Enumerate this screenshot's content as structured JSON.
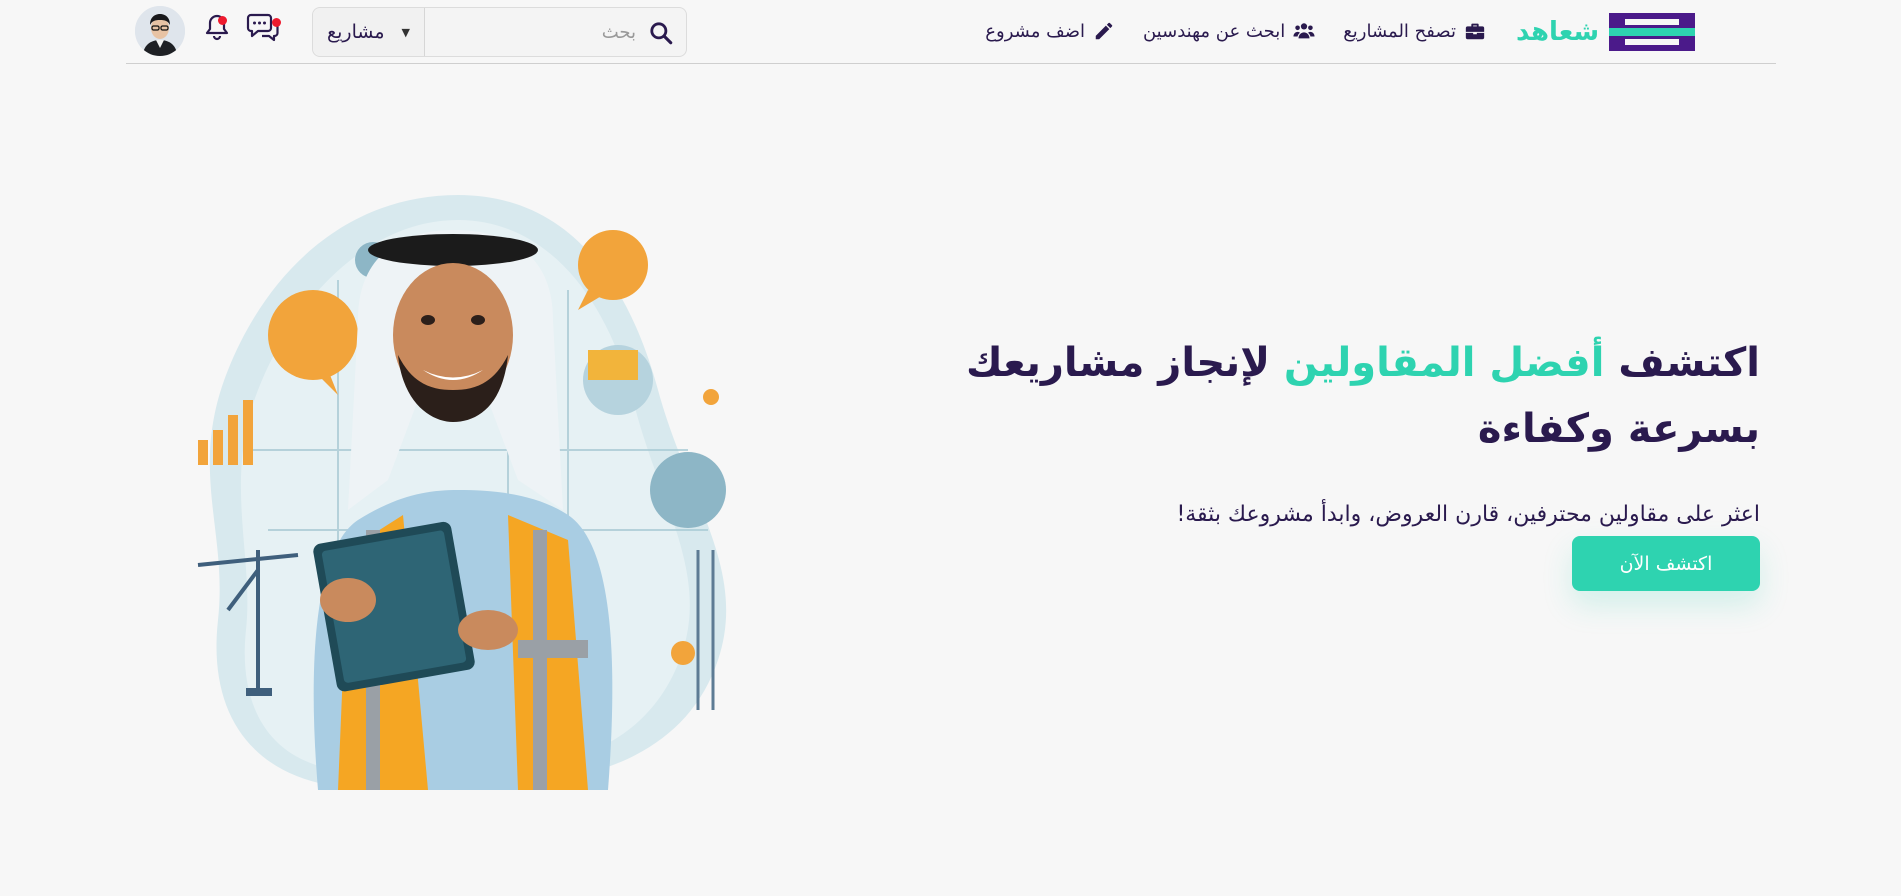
{
  "header": {
    "logo_text": "شعاهد",
    "nav": {
      "add_project": "اضف مشروع",
      "find_engineers": "ابحث عن مهندسين",
      "browse_projects": "تصفح المشاريع"
    },
    "search": {
      "placeholder": "بحث",
      "category_selected": "مشاريع"
    },
    "notifications": {
      "chat_unread": true,
      "bell_unread": true
    }
  },
  "hero": {
    "title_part1": "اكتشف ",
    "title_accent": "أفضل المقاولين",
    "title_part2": " لإنجاز مشاريعك بسرعة وكفاءة",
    "subtitle": "اعثر على مقاولين محترفين، قارن العروض، وابدأ مشروعك بثقة!",
    "cta_label": "اكتشف الآن"
  },
  "colors": {
    "brand_primary": "#2a1a4e",
    "brand_accent": "#2ed3b0",
    "logo_purple": "#4b1a8a",
    "notification_dot": "#ee1b2f",
    "background": "#f7f7f7"
  },
  "icons": {
    "add_project": "pencil-icon",
    "find_engineers": "users-icon",
    "browse_projects": "briefcase-icon",
    "search": "search-icon",
    "chat": "chat-icon",
    "bell": "bell-icon"
  }
}
